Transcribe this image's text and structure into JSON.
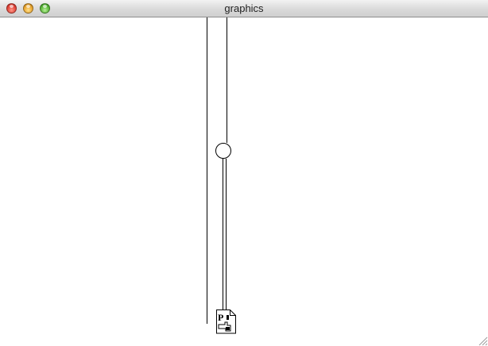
{
  "window": {
    "title": "graphics"
  },
  "colors": {
    "stroke": "#000000",
    "background": "#ffffff"
  },
  "icons": {
    "close": "close-button-icon",
    "minimize": "minimize-button-icon",
    "zoom": "zoom-button-icon",
    "document": "document-icon",
    "resize": "resize-grip-icon"
  },
  "document_icon": {
    "letter": "P"
  }
}
